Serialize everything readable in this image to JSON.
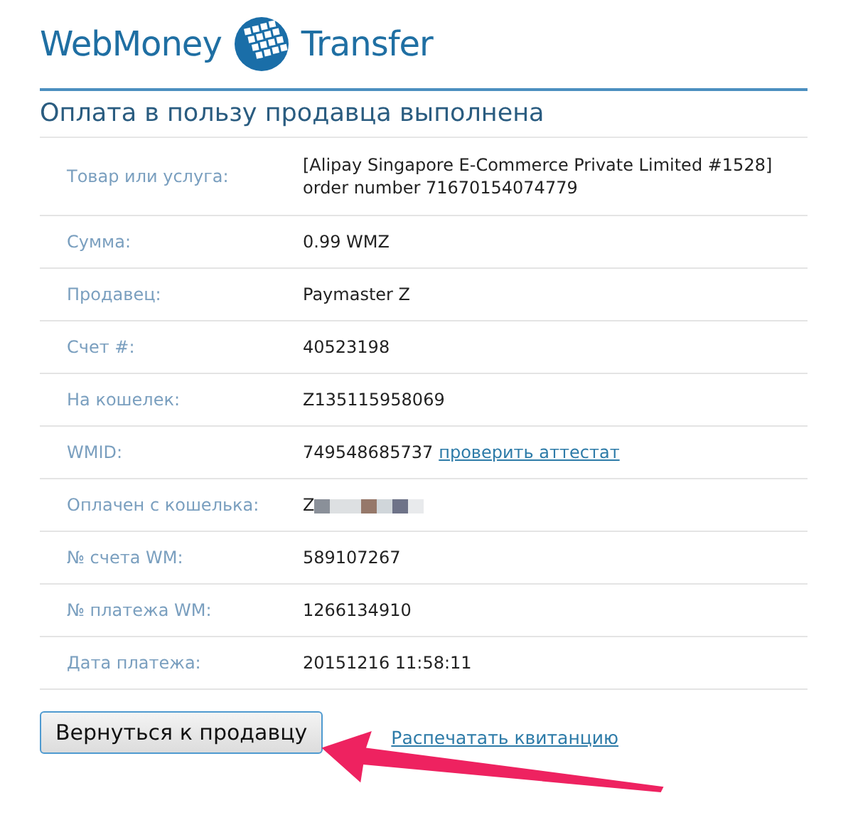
{
  "logo": {
    "brand": "WebMoney",
    "product": "Transfer"
  },
  "title": "Оплата в пользу продавца выполнена",
  "rows": [
    {
      "label": "Товар или услуга:",
      "value": "[Alipay Singapore E-Commerce Private Limited #1528] order number 71670154074779"
    },
    {
      "label": "Сумма:",
      "value": "0.99 WMZ"
    },
    {
      "label": "Продавец:",
      "value": "Paymaster Z"
    },
    {
      "label": "Счет #:",
      "value": "40523198"
    },
    {
      "label": "На кошелек:",
      "value": "Z135115958069"
    },
    {
      "label": "WMID:",
      "value": "749548685737",
      "link": "проверить аттестат"
    },
    {
      "label": "Оплачен с кошелька:",
      "value": "Z",
      "redacted": true
    },
    {
      "label": "№ счета WM:",
      "value": "589107267"
    },
    {
      "label": "№ платежа WM:",
      "value": "1266134910"
    },
    {
      "label": "Дата платежа:",
      "value": "20151216 11:58:11"
    }
  ],
  "button": "Вернуться к продавцу",
  "print_link": "Распечатать квитанцию"
}
